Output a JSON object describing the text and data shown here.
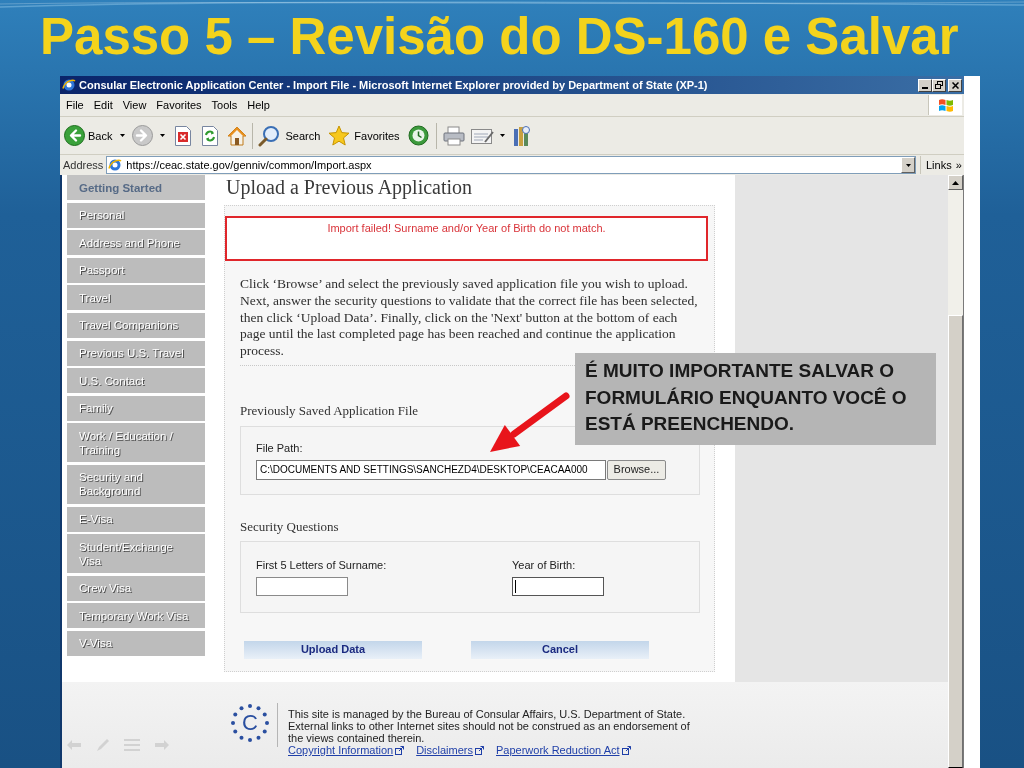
{
  "slide": {
    "title": "Passo 5 – Revisão do DS-160 e Salvar"
  },
  "window": {
    "title": "Consular Electronic Application Center - Import File - Microsoft Internet Explorer provided by Department of State (XP-1)"
  },
  "menu": [
    "File",
    "Edit",
    "View",
    "Favorites",
    "Tools",
    "Help"
  ],
  "toolbar": {
    "back_label": "Back",
    "search_label": "Search",
    "favorites_label": "Favorites"
  },
  "address_bar": {
    "label": "Address",
    "url": "https://ceac.state.gov/genniv/common/Import.aspx",
    "links_label": "Links",
    "links_chevron": "»"
  },
  "sidebar": {
    "items": [
      {
        "label": "Getting Started",
        "selected": true
      },
      {
        "label": "Personal",
        "selected": false
      },
      {
        "label": "Address and Phone",
        "selected": false
      },
      {
        "label": "Passport",
        "selected": false
      },
      {
        "label": "Travel",
        "selected": false
      },
      {
        "label": "Travel Companions",
        "selected": false
      },
      {
        "label": "Previous U.S. Travel",
        "selected": false
      },
      {
        "label": "U.S. Contact",
        "selected": false
      },
      {
        "label": "Family",
        "selected": false
      },
      {
        "label": "Work / Education / Training",
        "selected": false
      },
      {
        "label": "Security and Background",
        "selected": false
      },
      {
        "label": "E-Visa",
        "selected": false
      },
      {
        "label": "Student/Exchange Visa",
        "selected": false
      },
      {
        "label": "Crew Visa",
        "selected": false
      },
      {
        "label": "Temporary Work Visa",
        "selected": false
      },
      {
        "label": "V-Visa",
        "selected": false
      }
    ]
  },
  "page": {
    "heading": "Upload a Previous Application",
    "error": "Import failed! Surname and/or Year of Birth do not match.",
    "instructions": "Click ‘Browse’ and select the previously saved application file you wish to upload. Next, answer the security questions to validate that the correct file has been selected, then click ‘Upload Data’. Finally, click on the 'Next' button at the bottom of each page until the last completed page has been reached and continue the application process.",
    "file_section": {
      "title": "Previously Saved Application File",
      "label": "File Path:",
      "value": "C:\\DOCUMENTS AND SETTINGS\\SANCHEZD4\\DESKTOP\\CEACAA000",
      "button": "Browse..."
    },
    "security_section": {
      "title": "Security Questions",
      "fields": [
        {
          "label": "First 5 Letters of Surname:",
          "focused": false
        },
        {
          "label": "Year of Birth:",
          "focused": true
        }
      ]
    },
    "buttons": [
      "Upload Data",
      "Cancel"
    ]
  },
  "footer": {
    "logo_letter": "C",
    "text": "This site is managed by the Bureau of Consular Affairs, U.S. Department of State. External links to other Internet sites should not be construed as an endorsement of the views contained therein.",
    "links": [
      "Copyright Information",
      "Disclaimers",
      "Paperwork Reduction Act"
    ]
  },
  "callout": {
    "lines": [
      "É MUITO IMPORTANTE SALVAR O",
      "FORMULÁRIO ENQUANTO VOCÊ O",
      "ESTÁ PREENCHENDO."
    ]
  }
}
